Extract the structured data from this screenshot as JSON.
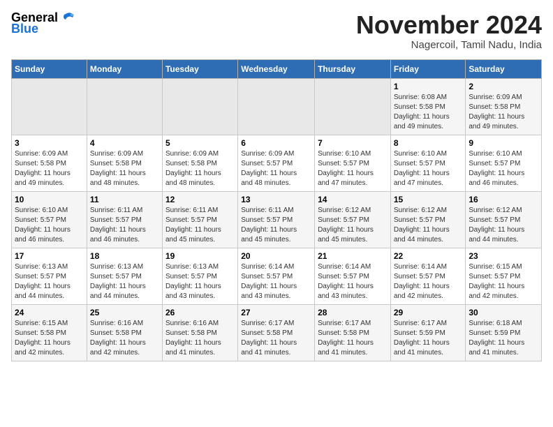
{
  "logo": {
    "text_general": "General",
    "text_blue": "Blue"
  },
  "title": "November 2024",
  "subtitle": "Nagercoil, Tamil Nadu, India",
  "days_of_week": [
    "Sunday",
    "Monday",
    "Tuesday",
    "Wednesday",
    "Thursday",
    "Friday",
    "Saturday"
  ],
  "weeks": [
    [
      {
        "day": "",
        "info": ""
      },
      {
        "day": "",
        "info": ""
      },
      {
        "day": "",
        "info": ""
      },
      {
        "day": "",
        "info": ""
      },
      {
        "day": "",
        "info": ""
      },
      {
        "day": "1",
        "info": "Sunrise: 6:08 AM\nSunset: 5:58 PM\nDaylight: 11 hours\nand 49 minutes."
      },
      {
        "day": "2",
        "info": "Sunrise: 6:09 AM\nSunset: 5:58 PM\nDaylight: 11 hours\nand 49 minutes."
      }
    ],
    [
      {
        "day": "3",
        "info": "Sunrise: 6:09 AM\nSunset: 5:58 PM\nDaylight: 11 hours\nand 49 minutes."
      },
      {
        "day": "4",
        "info": "Sunrise: 6:09 AM\nSunset: 5:58 PM\nDaylight: 11 hours\nand 48 minutes."
      },
      {
        "day": "5",
        "info": "Sunrise: 6:09 AM\nSunset: 5:58 PM\nDaylight: 11 hours\nand 48 minutes."
      },
      {
        "day": "6",
        "info": "Sunrise: 6:09 AM\nSunset: 5:57 PM\nDaylight: 11 hours\nand 48 minutes."
      },
      {
        "day": "7",
        "info": "Sunrise: 6:10 AM\nSunset: 5:57 PM\nDaylight: 11 hours\nand 47 minutes."
      },
      {
        "day": "8",
        "info": "Sunrise: 6:10 AM\nSunset: 5:57 PM\nDaylight: 11 hours\nand 47 minutes."
      },
      {
        "day": "9",
        "info": "Sunrise: 6:10 AM\nSunset: 5:57 PM\nDaylight: 11 hours\nand 46 minutes."
      }
    ],
    [
      {
        "day": "10",
        "info": "Sunrise: 6:10 AM\nSunset: 5:57 PM\nDaylight: 11 hours\nand 46 minutes."
      },
      {
        "day": "11",
        "info": "Sunrise: 6:11 AM\nSunset: 5:57 PM\nDaylight: 11 hours\nand 46 minutes."
      },
      {
        "day": "12",
        "info": "Sunrise: 6:11 AM\nSunset: 5:57 PM\nDaylight: 11 hours\nand 45 minutes."
      },
      {
        "day": "13",
        "info": "Sunrise: 6:11 AM\nSunset: 5:57 PM\nDaylight: 11 hours\nand 45 minutes."
      },
      {
        "day": "14",
        "info": "Sunrise: 6:12 AM\nSunset: 5:57 PM\nDaylight: 11 hours\nand 45 minutes."
      },
      {
        "day": "15",
        "info": "Sunrise: 6:12 AM\nSunset: 5:57 PM\nDaylight: 11 hours\nand 44 minutes."
      },
      {
        "day": "16",
        "info": "Sunrise: 6:12 AM\nSunset: 5:57 PM\nDaylight: 11 hours\nand 44 minutes."
      }
    ],
    [
      {
        "day": "17",
        "info": "Sunrise: 6:13 AM\nSunset: 5:57 PM\nDaylight: 11 hours\nand 44 minutes."
      },
      {
        "day": "18",
        "info": "Sunrise: 6:13 AM\nSunset: 5:57 PM\nDaylight: 11 hours\nand 44 minutes."
      },
      {
        "day": "19",
        "info": "Sunrise: 6:13 AM\nSunset: 5:57 PM\nDaylight: 11 hours\nand 43 minutes."
      },
      {
        "day": "20",
        "info": "Sunrise: 6:14 AM\nSunset: 5:57 PM\nDaylight: 11 hours\nand 43 minutes."
      },
      {
        "day": "21",
        "info": "Sunrise: 6:14 AM\nSunset: 5:57 PM\nDaylight: 11 hours\nand 43 minutes."
      },
      {
        "day": "22",
        "info": "Sunrise: 6:14 AM\nSunset: 5:57 PM\nDaylight: 11 hours\nand 42 minutes."
      },
      {
        "day": "23",
        "info": "Sunrise: 6:15 AM\nSunset: 5:57 PM\nDaylight: 11 hours\nand 42 minutes."
      }
    ],
    [
      {
        "day": "24",
        "info": "Sunrise: 6:15 AM\nSunset: 5:58 PM\nDaylight: 11 hours\nand 42 minutes."
      },
      {
        "day": "25",
        "info": "Sunrise: 6:16 AM\nSunset: 5:58 PM\nDaylight: 11 hours\nand 42 minutes."
      },
      {
        "day": "26",
        "info": "Sunrise: 6:16 AM\nSunset: 5:58 PM\nDaylight: 11 hours\nand 41 minutes."
      },
      {
        "day": "27",
        "info": "Sunrise: 6:17 AM\nSunset: 5:58 PM\nDaylight: 11 hours\nand 41 minutes."
      },
      {
        "day": "28",
        "info": "Sunrise: 6:17 AM\nSunset: 5:58 PM\nDaylight: 11 hours\nand 41 minutes."
      },
      {
        "day": "29",
        "info": "Sunrise: 6:17 AM\nSunset: 5:59 PM\nDaylight: 11 hours\nand 41 minutes."
      },
      {
        "day": "30",
        "info": "Sunrise: 6:18 AM\nSunset: 5:59 PM\nDaylight: 11 hours\nand 41 minutes."
      }
    ]
  ]
}
